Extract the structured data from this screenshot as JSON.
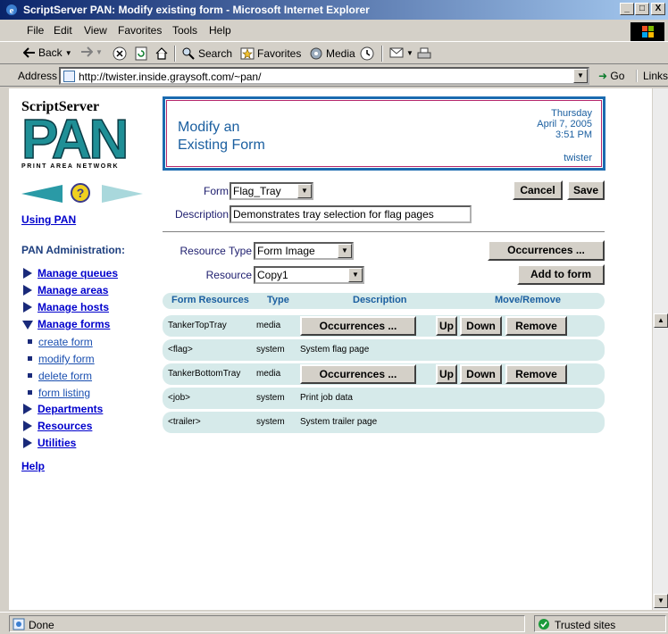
{
  "window": {
    "title": "ScriptServer PAN: Modify existing form - Microsoft Internet Explorer",
    "minimize": "_",
    "maximize": "□",
    "close": "X"
  },
  "menu": [
    "File",
    "Edit",
    "View",
    "Favorites",
    "Tools",
    "Help"
  ],
  "toolbar": {
    "back": "Back",
    "search": "Search",
    "favorites": "Favorites",
    "media": "Media"
  },
  "address": {
    "label": "Address",
    "url": "http://twister.inside.graysoft.com/~pan/",
    "go": "Go",
    "links": "Links"
  },
  "sidebar": {
    "logo_line1": "ScriptServer",
    "logo_line2": "PAN",
    "logo_line3": "PRINT AREA NETWORK",
    "using_pan": "Using PAN",
    "admin_heading": "PAN Administration:",
    "nav": [
      {
        "label": "Manage queues",
        "expanded": false
      },
      {
        "label": "Manage areas",
        "expanded": false
      },
      {
        "label": "Manage hosts",
        "expanded": false
      },
      {
        "label": "Manage forms",
        "expanded": true
      }
    ],
    "sub": [
      "create form",
      "modify form",
      "delete form",
      "form listing"
    ],
    "nav2": [
      "Departments",
      "Resources",
      "Utilities"
    ],
    "help": "Help"
  },
  "header": {
    "title_line1": "Modify an",
    "title_line2": "Existing Form",
    "day": "Thursday",
    "date": "April 7, 2005",
    "time": "3:51 PM",
    "host": "twister"
  },
  "form": {
    "form_label": "Form",
    "form_value": "Flag_Tray",
    "description_label": "Description",
    "description_value": "Demonstrates tray selection for flag pages",
    "cancel": "Cancel",
    "save": "Save",
    "resource_type_label": "Resource Type",
    "resource_type_value": "Form Image",
    "resource_label": "Resource",
    "resource_value": "Copy1",
    "occurrences": "Occurrences ...",
    "add_to_form": "Add to form"
  },
  "table": {
    "headers": {
      "resources": "Form Resources",
      "type": "Type",
      "description": "Description",
      "move": "Move/Remove"
    },
    "rows": [
      {
        "name": "TankerTopTray",
        "type": "media",
        "description": "",
        "has_buttons": true
      },
      {
        "name": "<flag>",
        "type": "system",
        "description": "System flag page",
        "has_buttons": false
      },
      {
        "name": "TankerBottomTray",
        "type": "media",
        "description": "",
        "has_buttons": true
      },
      {
        "name": "<job>",
        "type": "system",
        "description": "Print job data",
        "has_buttons": false
      },
      {
        "name": "<trailer>",
        "type": "system",
        "description": "System trailer page",
        "has_buttons": false
      }
    ],
    "btn_occurrences": "Occurrences ...",
    "btn_up": "Up",
    "btn_down": "Down",
    "btn_remove": "Remove"
  },
  "status": {
    "text": "Done",
    "zone": "Trusted sites"
  }
}
